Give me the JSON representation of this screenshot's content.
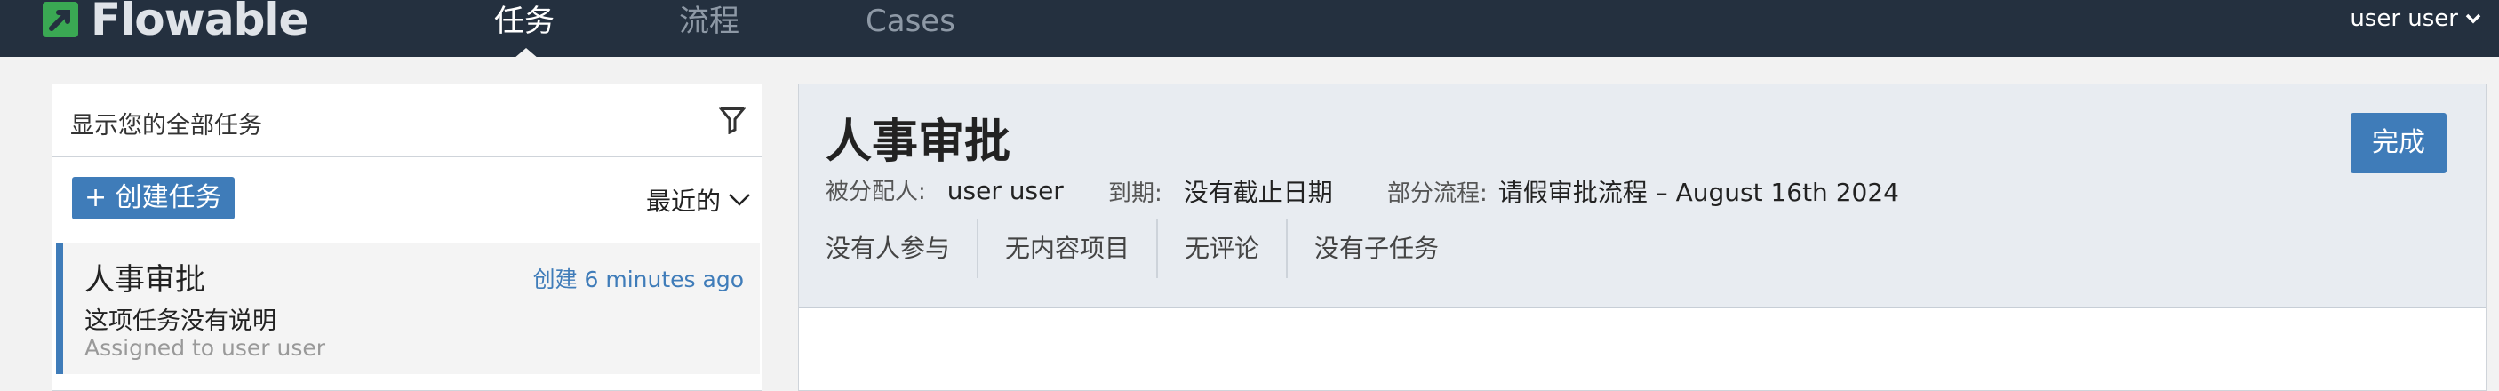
{
  "brand": {
    "name": "Flowable"
  },
  "nav": {
    "items": [
      {
        "label": "任务",
        "active": true
      },
      {
        "label": "流程",
        "active": false
      },
      {
        "label": "Cases",
        "active": false
      }
    ],
    "user": {
      "label": "user user",
      "icon": "chevron-down-icon"
    }
  },
  "task_list": {
    "filter_label": "显示您的全部任务",
    "filter_icon": "filter-icon",
    "create_button": "+ 创建任务",
    "sort_label": "最近的",
    "tasks": [
      {
        "title": "人事审批",
        "created": "创建 6 minutes ago",
        "description": "这项任务没有说明",
        "assigned": "Assigned to user user"
      }
    ]
  },
  "task_detail": {
    "title": "人事审批",
    "complete_button": "完成",
    "assignee_label": "被分配人:",
    "assignee_value": "user user",
    "due_label": "到期:",
    "due_value": "没有截止日期",
    "process_label": "部分流程:",
    "process_value": "请假审批流程 – August 16th 2024",
    "tabs": [
      "没有人参与",
      "无内容项目",
      "无评论",
      "没有子任务"
    ]
  },
  "colors": {
    "topbar": "#24303f",
    "accent": "#3f7cb9",
    "logo_green": "#3aa853"
  }
}
